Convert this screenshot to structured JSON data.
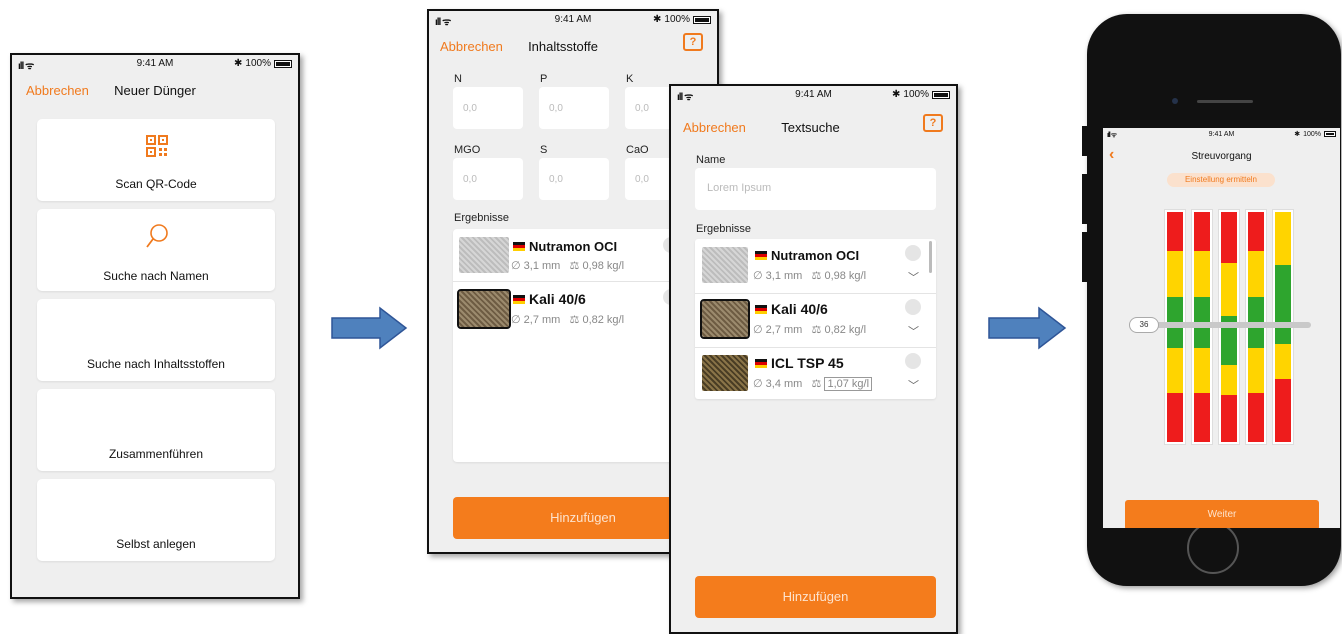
{
  "status_bar": {
    "time": "9:41 AM",
    "battery": "100%"
  },
  "icons": {
    "signal": "signal-wifi-icon",
    "battery": "battery-icon",
    "help": "help-chat-icon",
    "qr": "qr-code-icon",
    "search": "magnifier-icon",
    "arrow": "right-arrow-icon",
    "back": "back-chevron-icon",
    "diameter": "diameter-icon",
    "density": "density-icon",
    "dropdown": "chevron-down-icon"
  },
  "colors": {
    "accent": "#f07a1e",
    "arrow": "#4f81bd",
    "bar_red": "#ee1c1c",
    "bar_yellow": "#ffd400",
    "bar_green": "#2ea52e"
  },
  "screen1": {
    "cancel": "Abbrechen",
    "title": "Neuer Dünger",
    "menu": [
      "Scan QR-Code",
      "Suche nach Namen",
      "Suche nach Inhaltsstoffen",
      "Zusammenführen",
      "Selbst anlegen"
    ]
  },
  "screen2": {
    "cancel": "Abbrechen",
    "title": "Inhaltsstoffe",
    "fields": [
      {
        "label": "N",
        "value": "0,0"
      },
      {
        "label": "P",
        "value": "0,0"
      },
      {
        "label": "K",
        "value": "0,0"
      },
      {
        "label": "MGO",
        "value": "0,0"
      },
      {
        "label": "S",
        "value": "0,0"
      },
      {
        "label": "CaO",
        "value": "0,0"
      }
    ],
    "results_label": "Ergebnisse",
    "results": [
      {
        "name": "Nutramon OCI",
        "diameter": "3,1 mm",
        "density": "0,98 kg/l"
      },
      {
        "name": "Kali 40/6",
        "diameter": "2,7 mm",
        "density": "0,82 kg/l"
      }
    ],
    "add_button": "Hinzufügen"
  },
  "screen3": {
    "cancel": "Abbrechen",
    "title": "Textsuche",
    "name_label": "Name",
    "name_placeholder": "Lorem Ipsum",
    "results_label": "Ergebnisse",
    "results": [
      {
        "name": "Nutramon OCI",
        "diameter": "3,1 mm",
        "density": "0,98 kg/l"
      },
      {
        "name": "Kali 40/6",
        "diameter": "2,7 mm",
        "density": "0,82 kg/l"
      },
      {
        "name": "ICL TSP 45",
        "diameter": "3,4 mm",
        "density": "1,07 kg/l"
      }
    ],
    "add_button": "Hinzufügen"
  },
  "screen4": {
    "title": "Streuvorgang",
    "status_chip": "Einstellung ermitteln",
    "slider_value": "36",
    "next_button": "Weiter",
    "bars": [
      [
        "red",
        "yellow",
        "green",
        "yellow",
        "red"
      ],
      [
        "red",
        "yellow",
        "green",
        "yellow",
        "red"
      ],
      [
        "red",
        "yellow",
        "green",
        "yellow",
        "red"
      ],
      [
        "red",
        "yellow",
        "green",
        "yellow",
        "red"
      ],
      [
        "yellow",
        "green",
        "yellow",
        "red"
      ]
    ]
  }
}
